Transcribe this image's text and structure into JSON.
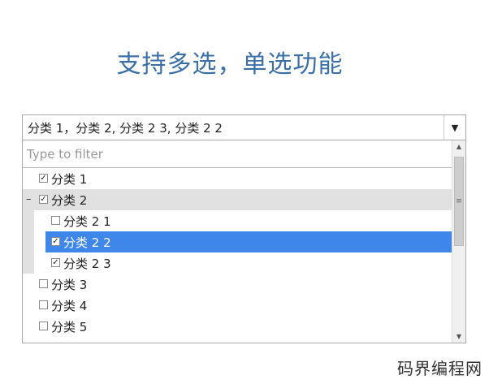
{
  "title": "支持多选，单选功能",
  "select": {
    "value": "分类 1，分类 2, 分类 2 3, 分类 2 2",
    "arrow_icon": "triangle-down-icon"
  },
  "filter": {
    "placeholder": "Type to filter",
    "value": ""
  },
  "tree": {
    "items": [
      {
        "label": "分类 1",
        "checked": true,
        "level": 0
      },
      {
        "label": "分类 2",
        "checked": true,
        "level": 0,
        "expanded": true,
        "toggle": "–"
      },
      {
        "label": "分类 2 1",
        "checked": false,
        "level": 1
      },
      {
        "label": "分类 2 2",
        "checked": true,
        "level": 1,
        "selected": true
      },
      {
        "label": "分类 2 3",
        "checked": true,
        "level": 1
      },
      {
        "label": "分类 3",
        "checked": false,
        "level": 0
      },
      {
        "label": "分类 4",
        "checked": false,
        "level": 0
      },
      {
        "label": "分类 5",
        "checked": false,
        "level": 0
      }
    ],
    "check_mark": "✓"
  },
  "scrollbar": {
    "up_icon": "▲",
    "down_icon": "▼",
    "grip": "≡"
  },
  "watermark": "码界编程网",
  "colors": {
    "title": "#3b6fa8",
    "selected_row": "#3e86ea",
    "expanded_row": "#e1e1e1"
  }
}
